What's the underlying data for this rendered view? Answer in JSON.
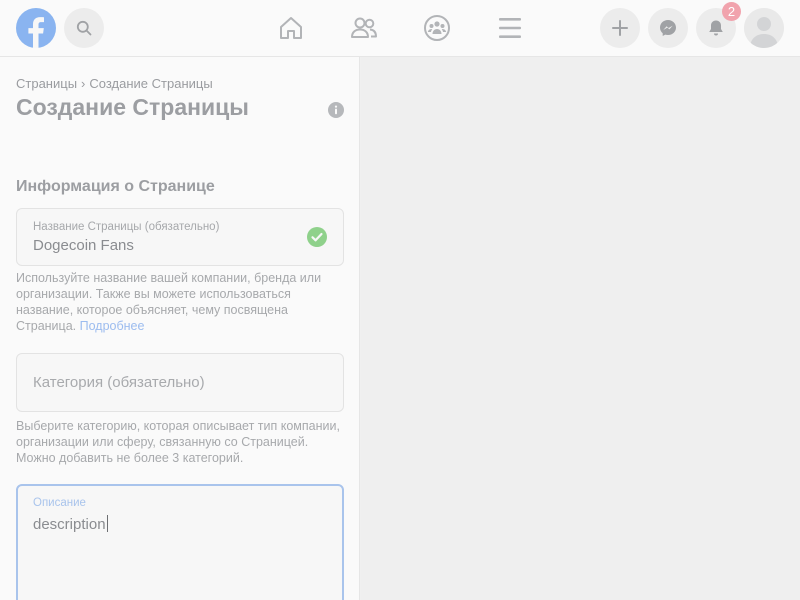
{
  "topbar": {
    "notifications_count": "2",
    "icons": [
      "facebook-logo-icon",
      "search-icon",
      "home-icon",
      "friends-icon",
      "groups-icon",
      "menu-icon",
      "plus-icon",
      "messenger-icon",
      "bell-icon",
      "avatar"
    ]
  },
  "breadcrumb": {
    "parent": "Страницы",
    "separator": "›",
    "current": "Создание Страницы"
  },
  "page_title": "Создание Страницы",
  "section_title": "Информация о Странице",
  "fields": {
    "name": {
      "label": "Название Страницы (обязательно)",
      "value": "Dogecoin Fans"
    },
    "name_helper": "Используйте название вашей компании, бренда или организации. Также вы можете использоваться название, которое объясняет, чему посвящена Страница.",
    "name_helper_link": "Подробнее",
    "category": {
      "placeholder": "Категория (обязательно)"
    },
    "category_helper": "Выберите категорию, которая описывает тип компании, организации или сферу, связанную со Страницей. Можно добавить не более 3 категорий.",
    "description": {
      "label": "Описание",
      "value": "description"
    }
  },
  "colors": {
    "accent": "#1877f2",
    "success": "#42b72a",
    "badge": "#f02849"
  }
}
